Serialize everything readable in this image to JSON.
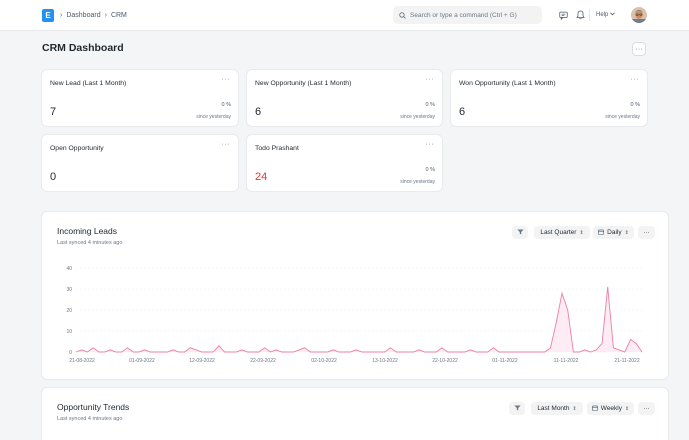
{
  "navbar": {
    "logo_letter": "E",
    "breadcrumb": [
      "Dashboard",
      "CRM"
    ],
    "search_placeholder": "Search or type a command (Ctrl + G)",
    "help_label": "Help"
  },
  "page": {
    "title": "CRM Dashboard",
    "menu_label": "···"
  },
  "number_cards": [
    {
      "title": "New Lead (Last 1 Month)",
      "value": "7",
      "change": "0 %",
      "since": "since yesterday"
    },
    {
      "title": "New Opportunity (Last 1 Month)",
      "value": "6",
      "change": "0 %",
      "since": "since yesterday"
    },
    {
      "title": "Won Opportunity (Last 1 Month)",
      "value": "6",
      "change": "0 %",
      "since": "since yesterday"
    },
    {
      "title": "Open Opportunity",
      "value": "0"
    },
    {
      "title": "Todo Prashant",
      "value": "24",
      "change": "0 %",
      "since": "since yesterday",
      "value_color": "#e03636"
    }
  ],
  "card_menu_label": "···",
  "incoming_leads": {
    "title": "Incoming Leads",
    "subtitle": "Last synced 4 minutes ago",
    "timespan": "Last Quarter",
    "interval": "Daily",
    "menu_label": "···"
  },
  "opportunity_trends": {
    "title": "Opportunity Trends",
    "subtitle": "Last synced 4 minutes ago",
    "timespan": "Last Month",
    "interval": "Weekly",
    "menu_label": "···"
  },
  "colors": {
    "accent": "#2490ef",
    "line": "#ec7fa8",
    "fill": "#fde7f0",
    "red_value": "#e03636"
  },
  "chart_data": {
    "type": "area",
    "ylim": [
      0,
      40
    ],
    "yticks": [
      0,
      10,
      20,
      30,
      40
    ],
    "xtick_labels": [
      "21-08-2022",
      "01-09-2022",
      "12-09-2022",
      "22-09-2022",
      "02-10-2022",
      "13-10-2022",
      "22-10-2022",
      "01-11-2022",
      "11-11-2022",
      "21-11-2022"
    ],
    "series": [
      {
        "values": [
          0,
          1,
          0,
          2,
          0,
          0,
          1,
          0,
          0,
          2,
          0,
          0,
          1,
          0,
          0,
          0,
          0,
          1,
          0,
          0,
          2,
          1,
          0,
          0,
          0,
          3,
          0,
          0,
          0,
          1,
          0,
          0,
          0,
          2,
          0,
          1,
          0,
          0,
          0,
          1,
          2,
          0,
          0,
          0,
          0,
          1,
          0,
          0,
          0,
          1,
          0,
          0,
          0,
          0,
          0,
          2,
          0,
          0,
          0,
          0,
          1,
          0,
          0,
          0,
          2,
          0,
          0,
          0,
          0,
          1,
          0,
          0,
          0,
          2,
          0,
          0,
          0,
          0,
          0,
          0,
          0,
          0,
          0,
          2,
          14,
          28,
          20,
          0,
          0,
          1,
          0,
          1,
          4,
          31,
          2,
          1,
          0,
          6,
          4,
          0
        ]
      }
    ]
  }
}
